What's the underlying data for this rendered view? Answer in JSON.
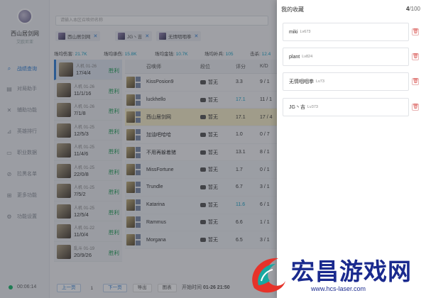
{
  "sidebar": {
    "user_name": "西山居剑网",
    "user_sub": "艾欧尼亚",
    "nav": [
      {
        "label": "战绩查询",
        "icon": "search-icon"
      },
      {
        "label": "对局助手",
        "icon": "clipboard-icon"
      },
      {
        "label": "辅助功能",
        "icon": "tools-icon"
      },
      {
        "label": "英雄排行",
        "icon": "chart-icon"
      },
      {
        "label": "职业数据",
        "icon": "folder-icon"
      },
      {
        "label": "拉黑名单",
        "icon": "block-icon"
      },
      {
        "label": "更多功能",
        "icon": "grid-icon"
      },
      {
        "label": "功能设置",
        "icon": "gear-icon"
      }
    ],
    "timer": "00:06:14"
  },
  "main": {
    "search_placeholder": "请输入本区召唤师名称",
    "chips": [
      "西山居剑网",
      "JG丶吉",
      "无情咽咽拳"
    ],
    "stats": [
      {
        "label": "场均伤害:",
        "value": "21.7K"
      },
      {
        "label": "场均承伤:",
        "value": "15.8K"
      },
      {
        "label": "场均金钱:",
        "value": "10.7K"
      },
      {
        "label": "场均补兵:",
        "value": "105"
      },
      {
        "label": "击杀:",
        "value": "12.4"
      }
    ],
    "matches": [
      {
        "mode": "人机 01-26",
        "kda": "17/4/4",
        "result": "胜利"
      },
      {
        "mode": "人机 01-26",
        "kda": "11/1/16",
        "result": "胜利"
      },
      {
        "mode": "人机 01-26",
        "kda": "7/1/8",
        "result": "胜利"
      },
      {
        "mode": "人机 01-25",
        "kda": "12/5/3",
        "result": "胜利"
      },
      {
        "mode": "人机 01-25",
        "kda": "11/4/6",
        "result": "胜利"
      },
      {
        "mode": "人机 01-25",
        "kda": "22/0/8",
        "result": "胜利"
      },
      {
        "mode": "人机 01-25",
        "kda": "7/5/2",
        "result": "胜利"
      },
      {
        "mode": "人机 01-25",
        "kda": "12/5/4",
        "result": "胜利"
      },
      {
        "mode": "人机 01-22",
        "kda": "11/0/4",
        "result": "胜利"
      },
      {
        "mode": "乱斗 01-19",
        "kda": "20/9/26",
        "result": "胜利"
      }
    ],
    "table_headers": [
      "召唤师",
      "段位",
      "评分",
      "K/D"
    ],
    "players": [
      {
        "name": "KissPosion9",
        "rank": "暂无",
        "score": "3.3",
        "kda": "9 / 1"
      },
      {
        "name": "luckhello",
        "rank": "暂无",
        "score": "17.1",
        "kda": "11 / 1"
      },
      {
        "name": "西山居剑网",
        "rank": "暂无",
        "score": "17.1",
        "kda": "17 / 4"
      },
      {
        "name": "加油吧哈哈",
        "rank": "暂无",
        "score": "1.0",
        "kda": "0 / 7"
      },
      {
        "name": "不用再躲着猪",
        "rank": "暂无",
        "score": "13.1",
        "kda": "8 / 1"
      },
      {
        "name": "MissFortune",
        "rank": "暂无",
        "score": "1.7",
        "kda": "0 / 1"
      },
      {
        "name": "Trundle",
        "rank": "暂无",
        "score": "6.7",
        "kda": "3 / 1"
      },
      {
        "name": "Katarina",
        "rank": "暂无",
        "score": "11.6",
        "kda": "6 / 1"
      },
      {
        "name": "Rammus",
        "rank": "暂无",
        "score": "6.6",
        "kda": "1 / 1"
      },
      {
        "name": "Morgana",
        "rank": "暂无",
        "score": "6.5",
        "kda": "3 / 1"
      }
    ],
    "pager": {
      "prev": "上一页",
      "page": "1",
      "next": "下一页",
      "btn1": "导出",
      "btn2": "图表"
    },
    "start_time_label": "开始时间",
    "start_time": "01-26 21:50"
  },
  "drawer": {
    "title": "我的收藏",
    "count_current": "4",
    "count_total": "/100",
    "favorites": [
      {
        "name": "miki",
        "level": "Lv673"
      },
      {
        "name": "plant",
        "level": "Lv824"
      },
      {
        "name": "无情咽咽拳",
        "level": "Lv73"
      },
      {
        "name": "JG丶吉",
        "level": "Lv373"
      }
    ]
  },
  "watermark": {
    "cn": "宏昌游戏网",
    "url": "www.hcs-laser.com"
  }
}
